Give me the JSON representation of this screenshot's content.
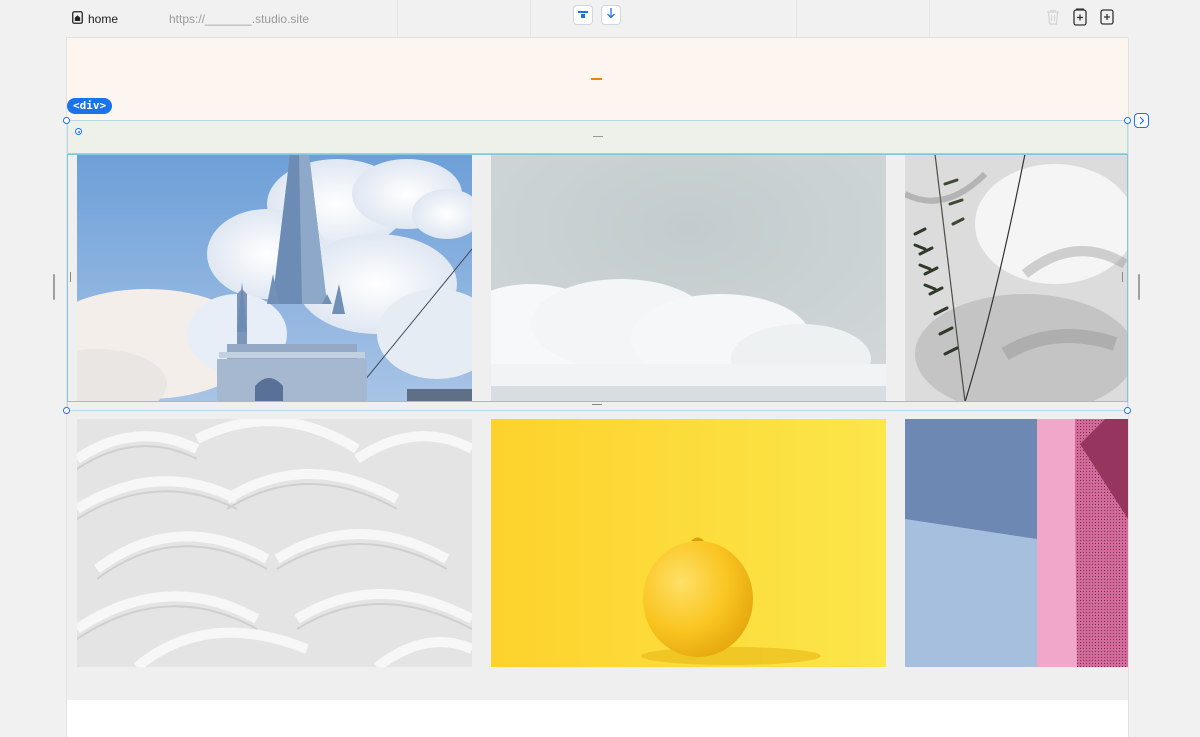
{
  "topbar": {
    "page_name": "home",
    "url": "https://_______.studio.site",
    "icons": [
      "home-page-icon",
      "align-top-icon",
      "arrow-down-icon",
      "trash-icon",
      "add-page-icon",
      "add-section-icon"
    ]
  },
  "selection": {
    "badge": "<div>"
  },
  "gallery": {
    "row1": [
      {
        "name": "church-spire-photo",
        "subject": "church spire against clouds"
      },
      {
        "name": "sky-clouds-photo",
        "subject": "clouds in grey-blue sky"
      },
      {
        "name": "plant-shadow-photo",
        "subject": "plant leaves with shadows"
      }
    ],
    "row2": [
      {
        "name": "white-texture-photo",
        "subject": "white brush-stroke plaster texture"
      },
      {
        "name": "lemon-photo",
        "subject": "lemon on yellow background"
      },
      {
        "name": "pastel-geometry-photo",
        "subject": "pastel blue and pink geometric shapes"
      }
    ]
  },
  "colors": {
    "accent": "#1a73e8",
    "header_bg": "#fdf6f0",
    "header_mark": "#e8850f",
    "band_bg": "#eef0ea",
    "selection_border": "#82c8dc"
  }
}
